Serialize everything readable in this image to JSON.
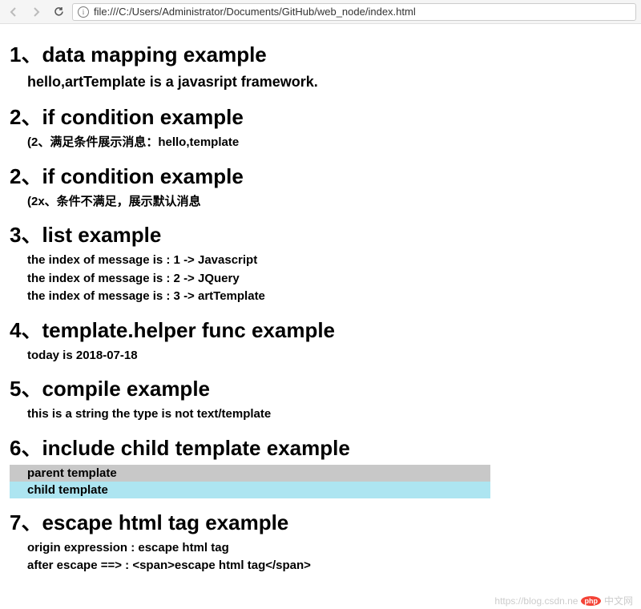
{
  "toolbar": {
    "url": "file:///C:/Users/Administrator/Documents/GitHub/web_node/index.html"
  },
  "sections": {
    "s1": {
      "heading": "1、data mapping example",
      "body": "hello,artTemplate is a javasript framework."
    },
    "s2a": {
      "heading": "2、if condition example",
      "body": "(2、满足条件展示消息：hello,template"
    },
    "s2b": {
      "heading": "2、if condition example",
      "body": "(2x、条件不满足，展示默认消息"
    },
    "s3": {
      "heading": "3、list example",
      "items": [
        "the index of message is : 1 -> Javascript",
        "the index of message is : 2 -> JQuery",
        "the index of message is : 3 -> artTemplate"
      ]
    },
    "s4": {
      "heading": "4、template.helper func example",
      "body": "today is 2018-07-18"
    },
    "s5": {
      "heading": "5、compile example",
      "body": "this is a string the type is not text/template"
    },
    "s6": {
      "heading": "6、include child template example",
      "parent": "parent template",
      "child": "child template"
    },
    "s7": {
      "heading": "7、escape html tag example",
      "line1": "origin expression : escape html tag",
      "line2": "after escape ==> : <span>escape html tag</span>"
    }
  },
  "watermark": {
    "url": "https://blog.csdn.ne",
    "badge": "php",
    "text": "中文网"
  }
}
